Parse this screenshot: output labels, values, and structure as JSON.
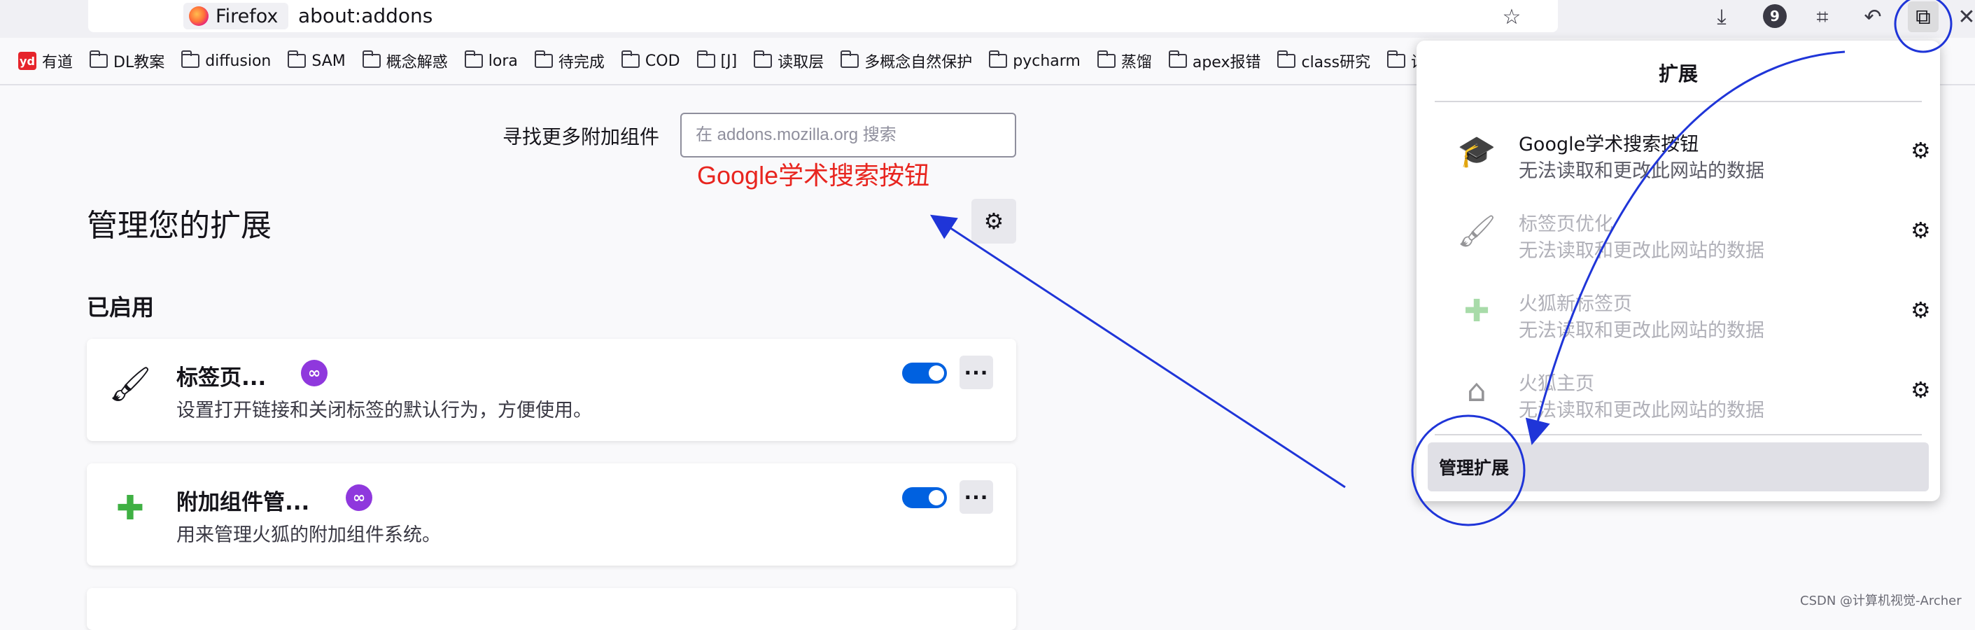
{
  "browser": {
    "identity_label": "Firefox",
    "url": "about:addons",
    "toolbar_badge": "9"
  },
  "bookmarks": [
    {
      "label": "有道",
      "icon": "youdao-logo"
    },
    {
      "label": "DL教案",
      "icon": "folder-icon"
    },
    {
      "label": "diffusion",
      "icon": "folder-icon"
    },
    {
      "label": "SAM",
      "icon": "folder-icon"
    },
    {
      "label": "概念解惑",
      "icon": "folder-icon"
    },
    {
      "label": "lora",
      "icon": "folder-icon"
    },
    {
      "label": "待完成",
      "icon": "folder-icon"
    },
    {
      "label": "COD",
      "icon": "folder-icon"
    },
    {
      "label": "[J]",
      "icon": "folder-icon"
    },
    {
      "label": "读取层",
      "icon": "folder-icon"
    },
    {
      "label": "多概念自然保护",
      "icon": "folder-icon"
    },
    {
      "label": "pycharm",
      "icon": "folder-icon"
    },
    {
      "label": "蒸馏",
      "icon": "folder-icon"
    },
    {
      "label": "apex报错",
      "icon": "folder-icon"
    },
    {
      "label": "class研究",
      "icon": "folder-icon"
    },
    {
      "label": "设备",
      "icon": "folder-icon"
    }
  ],
  "addons": {
    "search_label": "寻找更多附加组件",
    "search_placeholder": "在 addons.mozilla.org 搜索",
    "annotation_text": "Google学术搜索按钮",
    "page_title": "管理您的扩展",
    "section_enabled": "已启用",
    "cards": [
      {
        "name": "标签页...",
        "description": "设置打开链接和关闭标签的默认行为，方便使用。",
        "icon": "tab-options-icon",
        "enabled": true
      },
      {
        "name": "附加组件管...",
        "description": "用来管理火狐的附加组件系统。",
        "icon": "puzzle-icon",
        "enabled": true
      }
    ]
  },
  "extensions_panel": {
    "title": "扩展",
    "items": [
      {
        "name": "Google学术搜索按钮",
        "status": "无法读取和更改此网站的数据",
        "icon": "scholar-cap-icon",
        "dimmed": false
      },
      {
        "name": "标签页优化",
        "status": "无法读取和更改此网站的数据",
        "icon": "tab-options-icon",
        "dimmed": true
      },
      {
        "name": "火狐新标签页",
        "status": "无法读取和更改此网站的数据",
        "icon": "new-tab-icon",
        "dimmed": true
      },
      {
        "name": "火狐主页",
        "status": "无法读取和更改此网站的数据",
        "icon": "home-icon",
        "dimmed": true
      }
    ],
    "manage_label": "管理扩展"
  },
  "watermark": "CSDN @计算机视觉-Archer",
  "colors": {
    "accent": "#0061e0",
    "private_badge": "#8f38dd",
    "annotation_red": "#e8251f",
    "annotation_blue": "#1f35d8"
  }
}
